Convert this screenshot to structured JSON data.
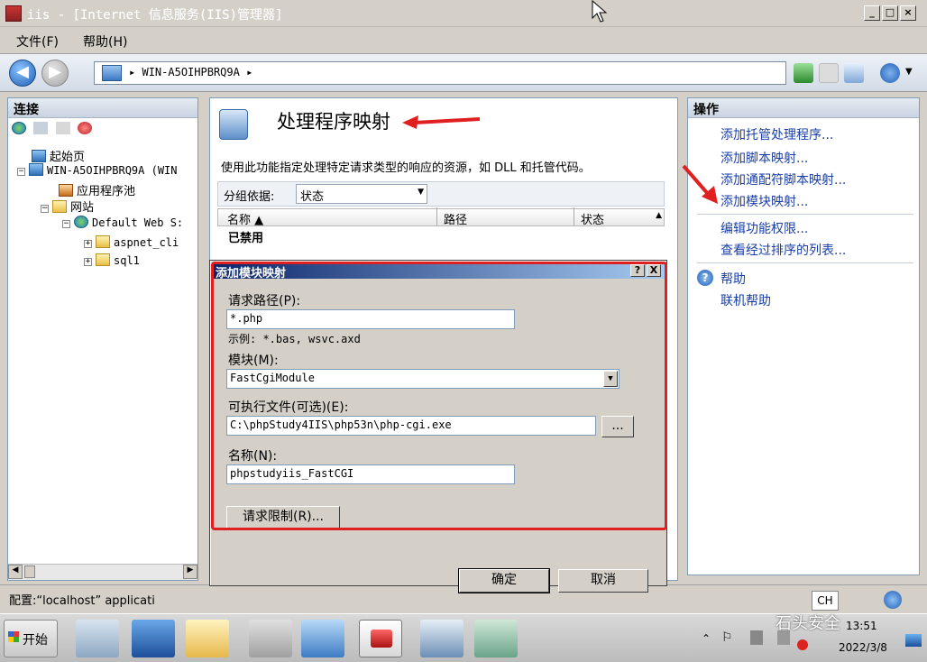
{
  "window": {
    "title": "iis - [Internet 信息服务(IIS)管理器]"
  },
  "menu": {
    "file": "文件(F)",
    "help": "帮助(H)"
  },
  "address": {
    "server": "WIN-A5OIHPBRQ9A",
    "separator": "▸"
  },
  "left_panel": {
    "title": "连接",
    "tree": [
      {
        "label": "起始页"
      },
      {
        "label": "WIN-A5OIHPBRQ9A (WIN"
      },
      {
        "label": "应用程序池"
      },
      {
        "label": "网站"
      },
      {
        "label": "Default Web S:"
      },
      {
        "label": "aspnet_cli"
      },
      {
        "label": "sql1"
      }
    ]
  },
  "center": {
    "heading": "处理程序映射",
    "description": "使用此功能指定处理特定请求类型的响应的资源，如 DLL 和托管代码。",
    "group_by_label": "分组依据:",
    "group_by_value": "状态",
    "columns": [
      "名称 ▲",
      "路径",
      "状态"
    ],
    "group_row": "已禁用"
  },
  "right_panel": {
    "title": "操作",
    "actions": [
      "添加托管处理程序...",
      "添加脚本映射...",
      "添加通配符脚本映射...",
      "添加模块映射...",
      "编辑功能权限...",
      "查看经过排序的列表...",
      "帮助",
      "联机帮助"
    ]
  },
  "dialog": {
    "title": "添加模块映射",
    "request_path_label": "请求路径(P):",
    "request_path_value": "*.php",
    "example_text": "示例: *.bas, wsvc.axd",
    "module_label": "模块(M):",
    "module_value": "FastCgiModule",
    "executable_label": "可执行文件(可选)(E):",
    "executable_value": "C:\\phpStudy4IIS\\php53n\\php-cgi.exe",
    "browse_label": "...",
    "name_label": "名称(N):",
    "name_value": "phpstudyiis_FastCGI",
    "request_restrictions_label": "请求限制(R)...",
    "ok_label": "确定",
    "cancel_label": "取消",
    "help_btn": "?",
    "close_btn": "X"
  },
  "statusbar": {
    "config": "配置:“localhost” applicati"
  },
  "taskbar": {
    "start": "开始",
    "ime": "CH",
    "time": "13:51",
    "date": "2022/3/8",
    "watermark": "石头安全"
  },
  "colors": {
    "annotation_red": "#e02020",
    "link_blue": "#1a3fa8",
    "title_blue": "#0a246a"
  }
}
